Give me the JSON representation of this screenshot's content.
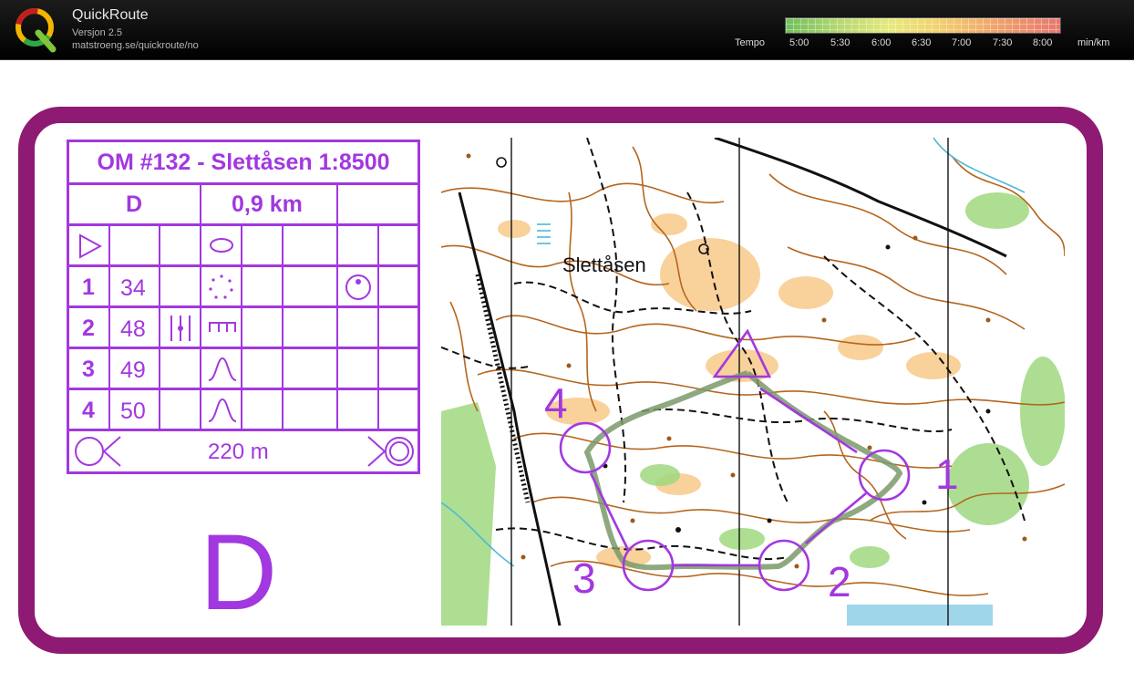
{
  "app": {
    "title": "QuickRoute",
    "version": "Versjon 2.5",
    "url": "matstroeng.se/quickroute/no",
    "logo_letter": "Q",
    "logo_icon": "quickroute-q-logo-icon"
  },
  "tempo": {
    "label": "Tempo",
    "ticks": [
      "5:00",
      "5:30",
      "6:00",
      "6:30",
      "7:00",
      "7:30",
      "8:00"
    ],
    "unit": "min/km"
  },
  "colors": {
    "frame": "#8e1a73",
    "course": "#a238e0",
    "route": "#7a9a6a",
    "contour": "#b5651d",
    "open_land": "#f8c98a",
    "forest_green": "#9fd87f",
    "path": "#111111",
    "water": "#4fb8d6"
  },
  "description_sheet": {
    "title": "OM #132 - Slettåsen 1:8500",
    "class": "D",
    "length": "0,9 km",
    "start_symbol": "start-triangle-icon",
    "controls": [
      {
        "number": "1",
        "code": "34",
        "symbols": [
          "dot-ring-icon",
          "knoll-circle-icon"
        ]
      },
      {
        "number": "2",
        "code": "48",
        "symbols": [
          "fence-crossing-icon",
          "comb-icon"
        ]
      },
      {
        "number": "3",
        "code": "49",
        "symbols": [
          "bell-curve-icon"
        ]
      },
      {
        "number": "4",
        "code": "50",
        "symbols": [
          "bell-curve-icon"
        ]
      }
    ],
    "finish_distance": "220 m",
    "finish_symbol_left": "finish-start-circle-icon",
    "finish_symbol_right": "finish-end-circle-icon",
    "large_class": "D"
  },
  "map": {
    "place_name": "Slettåsen",
    "control_labels": [
      "1",
      "2",
      "3",
      "4"
    ]
  }
}
